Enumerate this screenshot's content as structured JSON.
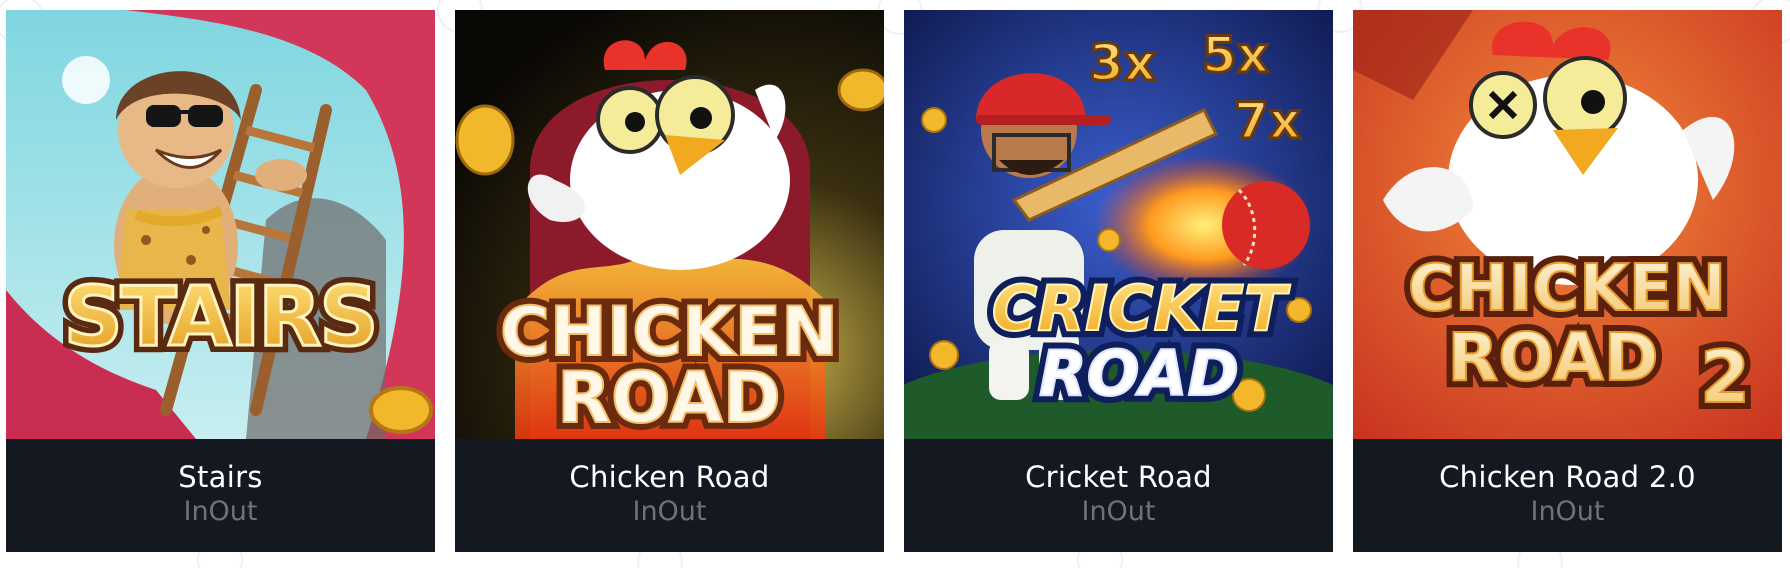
{
  "games": [
    {
      "title": "Stairs",
      "provider": "InOut",
      "thumbnail_text": [
        "STAIRS"
      ],
      "icon": "caveman-stairs-thumbnail"
    },
    {
      "title": "Chicken Road",
      "provider": "InOut",
      "thumbnail_text": [
        "CHICKEN",
        "ROAD"
      ],
      "icon": "chicken-road-thumbnail"
    },
    {
      "title": "Cricket Road",
      "provider": "InOut",
      "thumbnail_text": [
        "CRICKET",
        "ROAD"
      ],
      "multipliers": [
        "3x",
        "5x",
        "7x"
      ],
      "icon": "cricket-road-thumbnail"
    },
    {
      "title": "Chicken Road 2.0",
      "provider": "InOut",
      "thumbnail_text": [
        "CHICKEN",
        "ROAD",
        "2"
      ],
      "icon": "chicken-road-2-thumbnail"
    }
  ],
  "colors": {
    "card_bg": "#141821",
    "title": "#ffffff",
    "provider": "#6c717c",
    "page_bg": "#ffffff"
  }
}
